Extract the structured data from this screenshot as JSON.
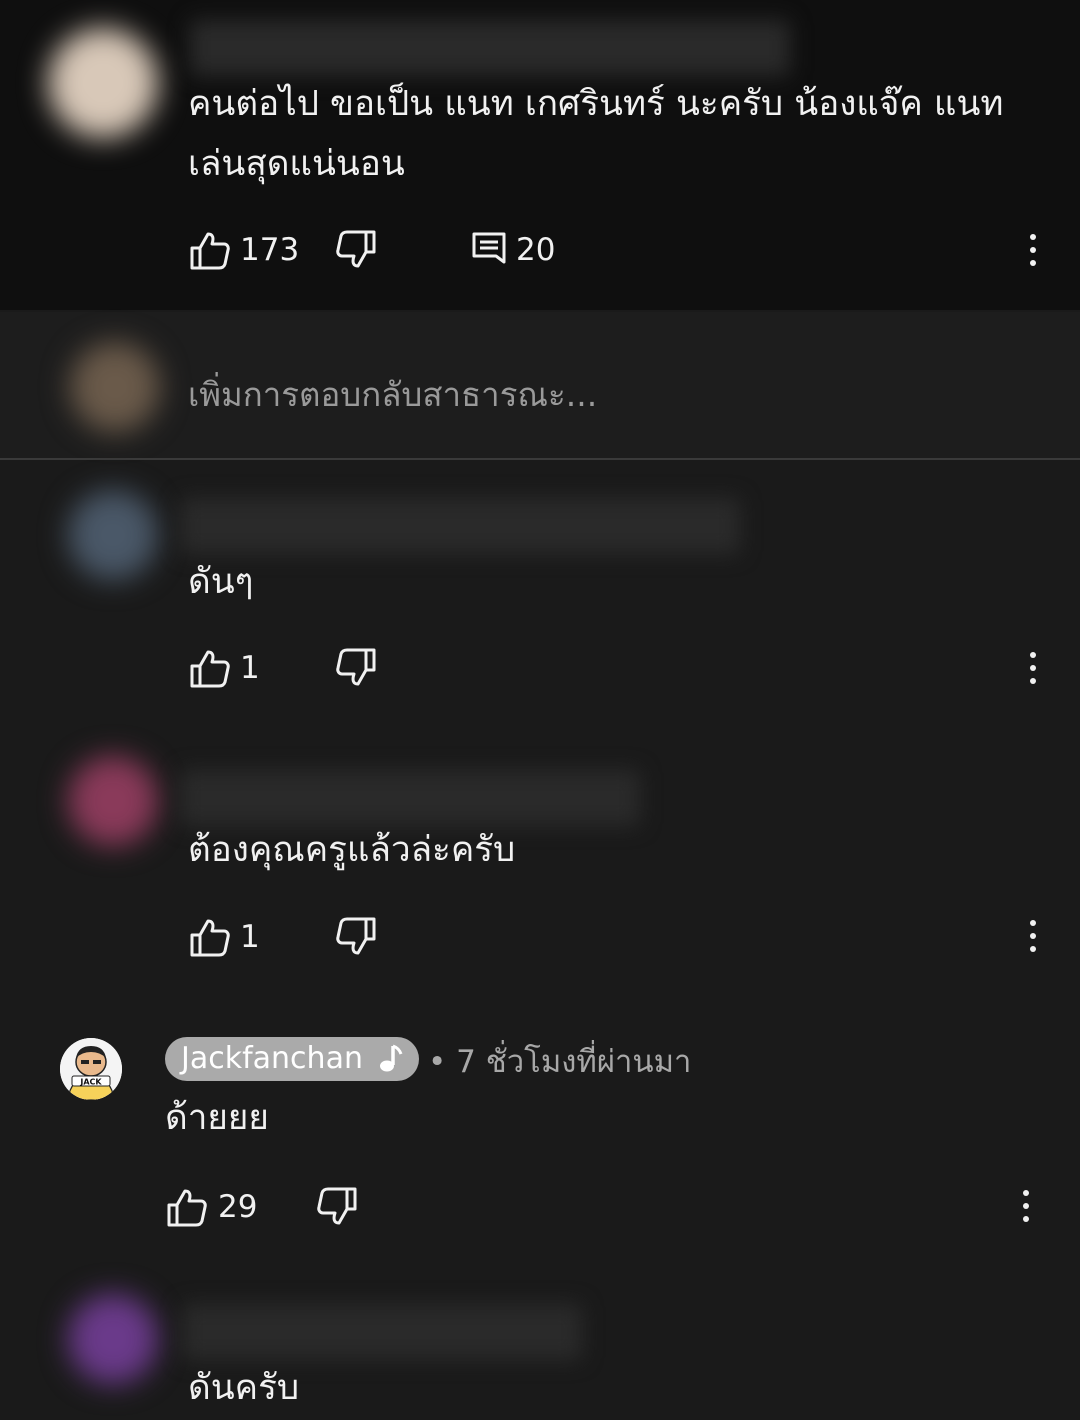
{
  "comments": [
    {
      "text_lines": [
        "คนต่อไป ขอเป็น แนท เกศรินทร์  นะครับ น้องแจ๊ค  แนท",
        "เล่นสุดแน่นอน"
      ],
      "likes": "173",
      "replies": "20"
    },
    {
      "text": "ดันๆ",
      "likes": "1"
    },
    {
      "text": "ต้องคุณครูแล้วล่ะครับ",
      "likes": "1"
    },
    {
      "author": "Jackfanchan",
      "time": "• 7 ชั่วโมงที่ผ่านมา",
      "text": "ด้ายยย",
      "likes": "29",
      "avatar_label": "JACK"
    },
    {
      "text": "ดันครับ"
    }
  ],
  "reply_box": {
    "placeholder": "เพิ่มการตอบกลับสาธารณะ..."
  },
  "icons": {
    "like": "thumbs-up-icon",
    "dislike": "thumbs-down-icon",
    "reply": "comment-icon",
    "more": "more-vert-icon",
    "music": "music-note-icon"
  },
  "colors": {
    "background": "#1a1a1a",
    "top_comment_bg": "#0f0f0f",
    "text": "#f1f1f1",
    "secondary_text": "#a8a8a8",
    "author_chip": "#aaaaaa"
  }
}
